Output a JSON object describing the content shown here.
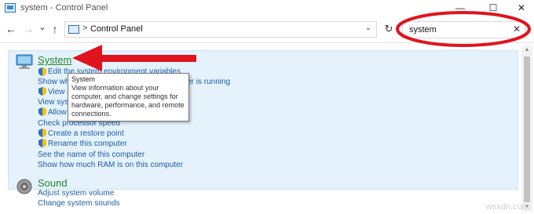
{
  "window": {
    "title": "system - Control Panel",
    "minimize_label": "—",
    "maximize_label": "☐",
    "close_label": "✕"
  },
  "nav": {
    "back_label": "←",
    "forward_label": "→",
    "recent_label": "⌄",
    "up_label": "↑",
    "address_separator": ">",
    "address_text": "Control Panel",
    "address_dropdown": "⌄",
    "refresh_label": "↻"
  },
  "search": {
    "value": "system",
    "clear_label": "✕"
  },
  "results": {
    "system": {
      "title": "System",
      "links": [
        "Edit the system environment variables",
        "Show which operating system your computer is running",
        "View a",
        "View syst",
        "Allow",
        "Check processor speed",
        "Create a restore point",
        "Rename this computer",
        "See the name of this computer",
        "Show how much RAM is on this computer"
      ]
    },
    "sound": {
      "title": "Sound",
      "links": [
        "Adjust system volume",
        "Change system sounds"
      ]
    }
  },
  "tooltip": {
    "title": "System",
    "lines": [
      "View information about your",
      "computer, and change settings for",
      "hardware, performance, and remote",
      "connections."
    ]
  },
  "annotations": {
    "circle_color": "#e0141e",
    "arrow_color": "#e0141e"
  },
  "watermark": "wsxdn.com"
}
